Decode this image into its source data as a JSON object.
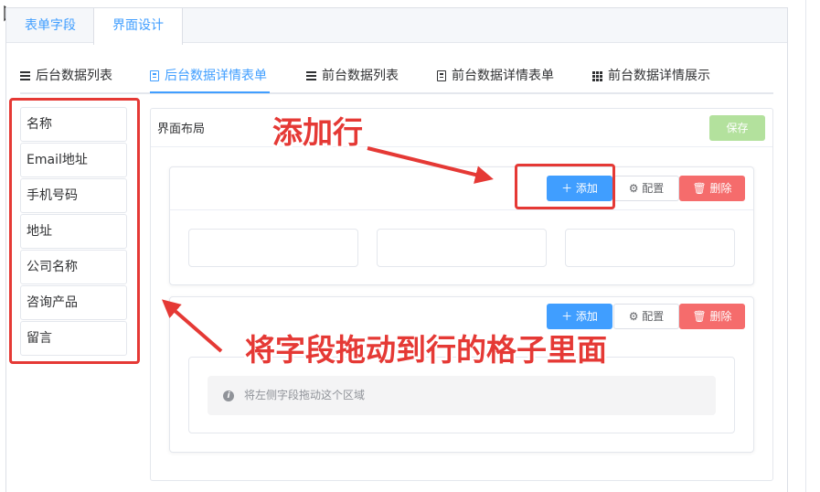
{
  "tabs": [
    {
      "label": "表单字段"
    },
    {
      "label": "界面设计"
    }
  ],
  "subtabs": [
    {
      "label": "后台数据列表",
      "icon": "list-icon"
    },
    {
      "label": "后台数据详情表单",
      "icon": "document-icon"
    },
    {
      "label": "前台数据列表",
      "icon": "list-icon"
    },
    {
      "label": "前台数据详情表单",
      "icon": "document-icon"
    },
    {
      "label": "前台数据详情展示",
      "icon": "grid-icon"
    }
  ],
  "fields": [
    "名称",
    "Email地址",
    "手机号码",
    "地址",
    "公司名称",
    "咨询产品",
    "留言"
  ],
  "layout": {
    "title": "界面布局",
    "save_label": "保存",
    "rows": [
      {
        "add_label": "添加",
        "config_label": "配置",
        "delete_label": "删除"
      },
      {
        "add_label": "添加",
        "config_label": "配置",
        "delete_label": "删除",
        "empty_hint": "将左侧字段拖动这个区域"
      }
    ]
  },
  "annotations": {
    "add_row": "添加行",
    "drag_hint": "将字段拖动到行的格子里面"
  },
  "colors": {
    "primary": "#409eff",
    "danger": "#f56c6c",
    "success_disabled": "#b3e19d",
    "annotation": "#e53935"
  }
}
